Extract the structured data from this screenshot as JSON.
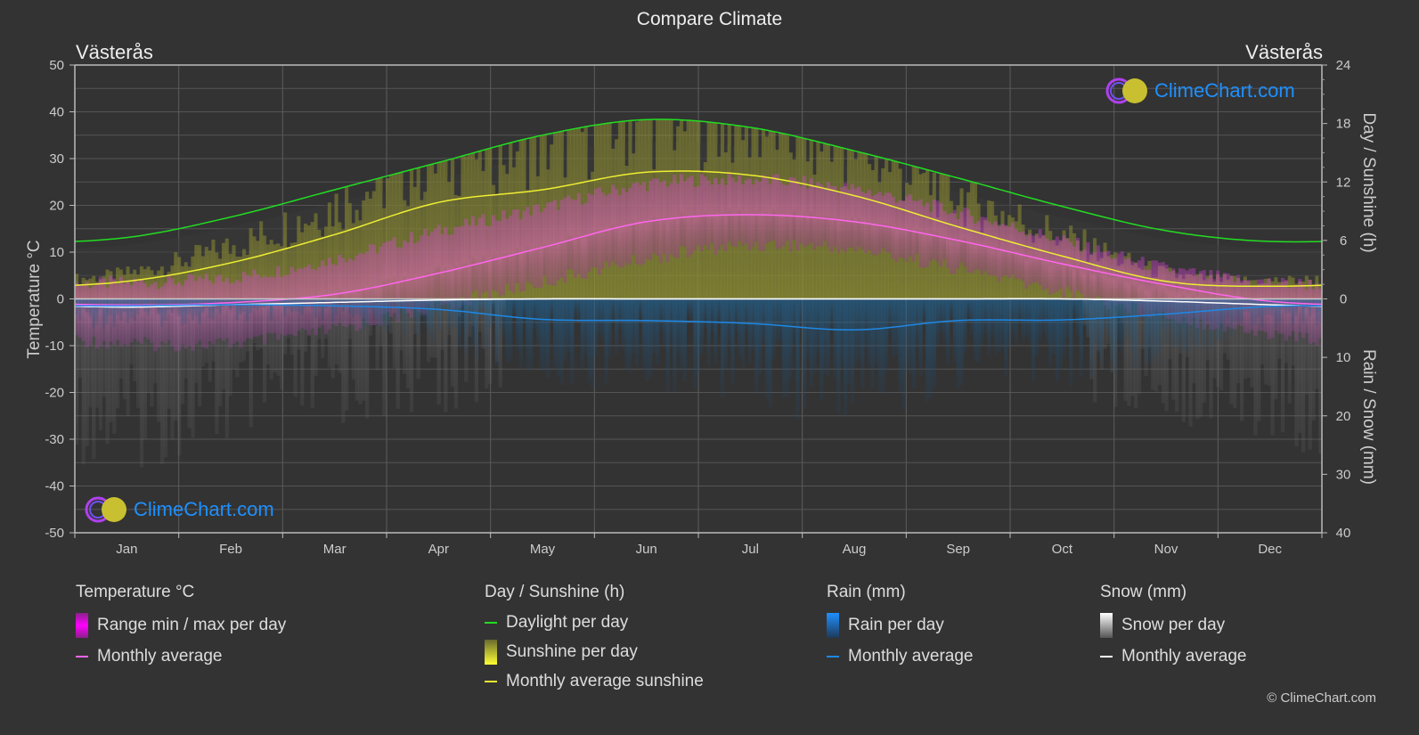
{
  "title": "Compare Climate",
  "city_left": "Västerås",
  "city_right": "Västerås",
  "logo_text": "ClimeChart.com",
  "copyright": "© ClimeChart.com",
  "colors": {
    "background": "#333333",
    "grid": "#5a5a5a",
    "temp_range": "#e040e0",
    "temp_avg": "#ff66ee",
    "daylight": "#22dd22",
    "sunshine_fill": "#c8c832",
    "sunshine_avg": "#eeee33",
    "rain": "#1e90ff",
    "rain_avg": "#1e88e5",
    "snow": "#cccccc",
    "snow_avg": "#ffffff",
    "logo": "#1e90ff"
  },
  "legend": {
    "temperature": {
      "title": "Temperature °C",
      "items": [
        {
          "type": "box",
          "label": "Range min / max per day"
        },
        {
          "type": "line",
          "label": "Monthly average"
        }
      ]
    },
    "sunshine": {
      "title": "Day / Sunshine (h)",
      "items": [
        {
          "type": "line",
          "label": "Daylight per day"
        },
        {
          "type": "box",
          "label": "Sunshine per day"
        },
        {
          "type": "line",
          "label": "Monthly average sunshine"
        }
      ]
    },
    "rain": {
      "title": "Rain (mm)",
      "items": [
        {
          "type": "box",
          "label": "Rain per day"
        },
        {
          "type": "line",
          "label": "Monthly average"
        }
      ]
    },
    "snow": {
      "title": "Snow (mm)",
      "items": [
        {
          "type": "box",
          "label": "Snow per day"
        },
        {
          "type": "line",
          "label": "Monthly average"
        }
      ]
    }
  },
  "chart_data": {
    "type": "line",
    "title": "Compare Climate",
    "categories": [
      "Jan",
      "Feb",
      "Mar",
      "Apr",
      "May",
      "Jun",
      "Jul",
      "Aug",
      "Sep",
      "Oct",
      "Nov",
      "Dec"
    ],
    "axes": {
      "left": {
        "label": "Temperature °C",
        "range": [
          -50,
          50
        ],
        "ticks": [
          50,
          40,
          30,
          20,
          10,
          0,
          -10,
          -20,
          -30,
          -40,
          -50
        ]
      },
      "right_top": {
        "label": "Day / Sunshine (h)",
        "range": [
          0,
          24
        ],
        "ticks": [
          24,
          18,
          12,
          6,
          0
        ]
      },
      "right_bottom": {
        "label": "Rain / Snow (mm)",
        "range": [
          0,
          40
        ],
        "ticks": [
          0,
          10,
          20,
          30,
          40
        ]
      }
    },
    "grid": true,
    "legend_position": "bottom",
    "series": [
      {
        "name": "Temperature monthly average (°C)",
        "axis": "left",
        "values": [
          -1.3,
          -0.8,
          1.0,
          5.5,
          11.0,
          16.5,
          18.0,
          16.5,
          12.5,
          7.5,
          3.0,
          -0.5
        ]
      },
      {
        "name": "Daylight per day (h)",
        "axis": "right_top",
        "values": [
          6.3,
          8.4,
          11.2,
          14.0,
          16.8,
          18.4,
          17.6,
          15.2,
          12.4,
          9.5,
          7.0,
          5.9
        ]
      },
      {
        "name": "Monthly average sunshine (h)",
        "axis": "right_top",
        "values": [
          1.8,
          3.7,
          6.6,
          9.9,
          11.2,
          13.0,
          12.7,
          10.6,
          7.4,
          4.4,
          1.8,
          1.3
        ]
      },
      {
        "name": "Rain monthly average (mm)",
        "axis": "right_bottom",
        "values": [
          1.2,
          1.0,
          1.2,
          1.8,
          3.5,
          3.7,
          4.2,
          5.3,
          3.7,
          3.6,
          2.6,
          1.3
        ]
      },
      {
        "name": "Snow monthly average (mm)",
        "axis": "right_bottom",
        "values": [
          1.4,
          1.0,
          0.6,
          0.2,
          0.0,
          0.0,
          0.0,
          0.0,
          0.0,
          0.0,
          0.4,
          1.0
        ]
      }
    ],
    "temp_range_approx": {
      "min": [
        -8,
        -8,
        -5,
        0,
        5,
        10,
        13,
        12,
        8,
        3,
        -2,
        -6
      ],
      "max": [
        2,
        3,
        7,
        13,
        18,
        23,
        24,
        22,
        17,
        11,
        5,
        2
      ]
    }
  }
}
